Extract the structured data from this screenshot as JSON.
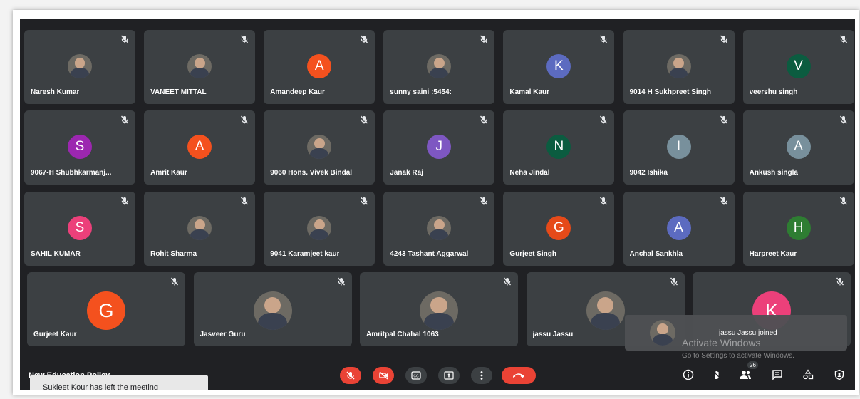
{
  "meeting": {
    "title": "New Education Policy"
  },
  "participants": [
    {
      "name": "Naresh Kumar",
      "avatar": "photo"
    },
    {
      "name": "VANEET MITTAL",
      "avatar": "photo"
    },
    {
      "name": "Amandeep Kaur",
      "avatar": "letter",
      "initial": "A",
      "color": "#f4511e"
    },
    {
      "name": "sunny saini :5454:",
      "avatar": "photo"
    },
    {
      "name": "Kamal Kaur",
      "avatar": "letter",
      "initial": "K",
      "color": "#5c6bc0"
    },
    {
      "name": "9014 H Sukhpreet Singh",
      "avatar": "photo"
    },
    {
      "name": "veershu singh",
      "avatar": "letter",
      "initial": "V",
      "color": "#0b5c40"
    },
    {
      "name": "9067-H Shubhkarmanj...",
      "avatar": "letter",
      "initial": "S",
      "color": "#9c27b0"
    },
    {
      "name": "Amrit Kaur",
      "avatar": "letter",
      "initial": "A",
      "color": "#f4511e"
    },
    {
      "name": "9060 Hons. Vivek Bindal",
      "avatar": "photo"
    },
    {
      "name": "Janak Raj",
      "avatar": "letter",
      "initial": "J",
      "color": "#7e57c2"
    },
    {
      "name": "Neha Jindal",
      "avatar": "letter",
      "initial": "N",
      "color": "#0b5c40"
    },
    {
      "name": "9042 Ishika",
      "avatar": "letter",
      "initial": "I",
      "color": "#78909c"
    },
    {
      "name": "Ankush singla",
      "avatar": "letter",
      "initial": "A",
      "color": "#78909c"
    },
    {
      "name": "SAHIL KUMAR",
      "avatar": "letter",
      "initial": "S",
      "color": "#ec407a"
    },
    {
      "name": "Rohit Sharma",
      "avatar": "photo"
    },
    {
      "name": "9041 Karamjeet kaur",
      "avatar": "photo"
    },
    {
      "name": "4243 Tashant Aggarwal",
      "avatar": "photo"
    },
    {
      "name": "Gurjeet Singh",
      "avatar": "letter",
      "initial": "G",
      "color": "#e64a19"
    },
    {
      "name": "Anchal Sankhla",
      "avatar": "letter",
      "initial": "A",
      "color": "#5c6bc0"
    },
    {
      "name": "Harpreet Kaur",
      "avatar": "letter",
      "initial": "H",
      "color": "#2e7d32"
    },
    {
      "name": "Gurjeet Kaur",
      "avatar": "letter",
      "initial": "G",
      "color": "#f4511e"
    },
    {
      "name": "Jasveer Guru",
      "avatar": "photo"
    },
    {
      "name": "Amritpal Chahal 1063",
      "avatar": "photo"
    },
    {
      "name": "jassu Jassu",
      "avatar": "photo"
    },
    {
      "name": "",
      "avatar": "letter",
      "initial": "K",
      "color": "#ec407a"
    }
  ],
  "participant_count": "26",
  "notifications": {
    "left": "Sukjeet Kour has left the meeting",
    "joined": "jassu Jassu joined"
  },
  "watermark": {
    "title": "Activate Windows",
    "subtitle": "Go to Settings to activate Windows."
  },
  "icons": {
    "tile_mute": "mic-off-icon",
    "controls": [
      "mic-off-icon",
      "camera-off-icon",
      "captions-icon",
      "present-icon",
      "more-options-icon",
      "end-call-icon"
    ],
    "right": [
      "info-icon",
      "raise-hand-icon",
      "people-icon",
      "chat-icon",
      "activities-icon",
      "host-controls-icon"
    ]
  },
  "colors": {
    "end_call": "#ea4335",
    "muted_button": "#ea4335",
    "tile": "#3c4043",
    "background": "#202124"
  }
}
